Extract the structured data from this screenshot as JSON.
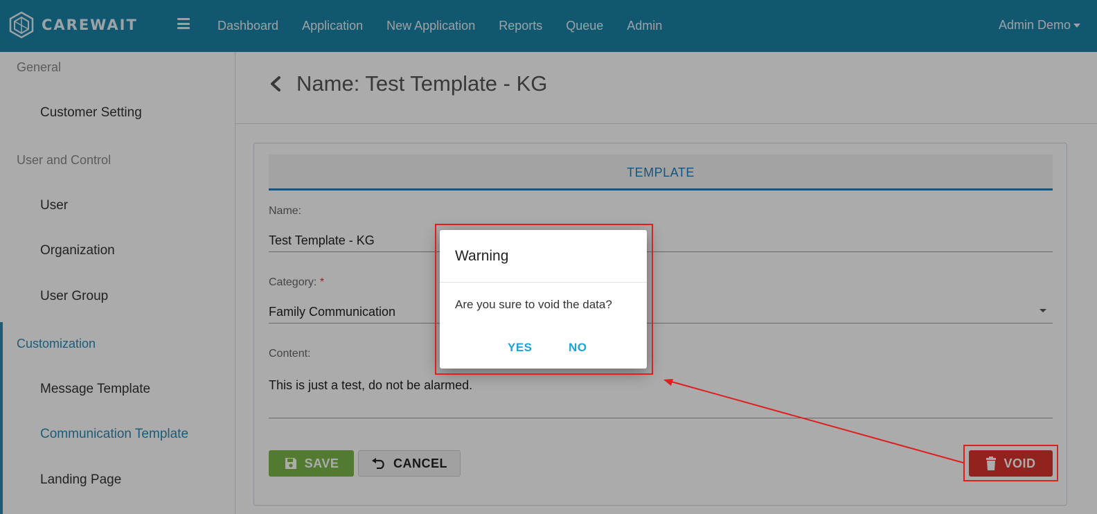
{
  "brand": {
    "name": "CAREWAIT"
  },
  "nav": {
    "items": [
      "Dashboard",
      "Application",
      "New Application",
      "Reports",
      "Queue",
      "Admin"
    ],
    "user": "Admin Demo"
  },
  "sidebar": {
    "groups": [
      {
        "header": "General",
        "items": [
          "Customer Setting"
        ]
      },
      {
        "header": "User and Control",
        "items": [
          "User",
          "Organization",
          "User Group"
        ]
      },
      {
        "header": "Customization",
        "items": [
          "Message Template",
          "Communication Template",
          "Landing Page"
        ]
      }
    ],
    "active_group": "Customization",
    "active_item": "Communication Template"
  },
  "page": {
    "title": "Name: Test Template - KG"
  },
  "form": {
    "tab": "TEMPLATE",
    "name_label": "Name:",
    "name_value": "Test Template - KG",
    "category_label": "Category:",
    "required_mark": "*",
    "category_value": "Family Communication",
    "content_label": "Content:",
    "content_value": "This is just a test, do not be alarmed."
  },
  "buttons": {
    "save": "SAVE",
    "cancel": "CANCEL",
    "void": "VOID"
  },
  "dialog": {
    "title": "Warning",
    "message": "Are you sure to void the data?",
    "yes": "YES",
    "no": "NO"
  },
  "colors": {
    "topbar": "#1a82a8",
    "accent": "#1f7fbf",
    "save": "#7bb84a",
    "void": "#d9332e",
    "annotation": "#e01e1e"
  }
}
